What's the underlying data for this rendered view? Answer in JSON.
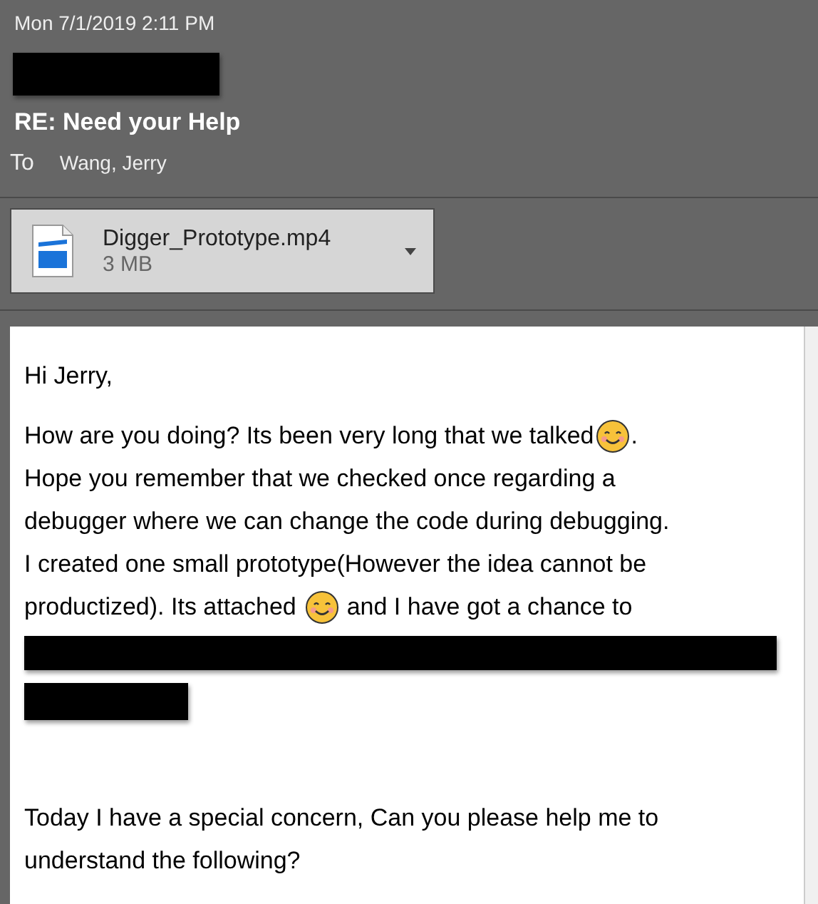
{
  "header": {
    "date": "Mon 7/1/2019 2:11 PM",
    "sender_redacted": true,
    "subject": "RE: Need your Help",
    "to_label": "To",
    "to": "Wang, Jerry"
  },
  "attachment": {
    "name": "Digger_Prototype.mp4",
    "size": "3 MB"
  },
  "body": [
    {
      "kind": "text",
      "segments": [
        {
          "kind": "text",
          "text": "Hi Jerry,"
        }
      ]
    },
    {
      "kind": "gap"
    },
    {
      "kind": "text",
      "segments": [
        {
          "kind": "text",
          "text": "How are you doing? Its been very long that we talked"
        },
        {
          "kind": "emoji"
        },
        {
          "kind": "text",
          "text": "."
        }
      ]
    },
    {
      "kind": "text",
      "segments": [
        {
          "kind": "text",
          "text": "Hope you remember that we checked once regarding a"
        }
      ]
    },
    {
      "kind": "text",
      "segments": [
        {
          "kind": "text",
          "text": "debugger where we can change the code during debugging."
        }
      ]
    },
    {
      "kind": "text",
      "segments": [
        {
          "kind": "text",
          "text": "I created one small prototype(However the idea cannot be"
        }
      ]
    },
    {
      "kind": "text",
      "segments": [
        {
          "kind": "text",
          "text": "productized). Its attached "
        },
        {
          "kind": "emoji"
        },
        {
          "kind": "text",
          "text": " and I have got a chance to"
        }
      ]
    },
    {
      "kind": "redacted",
      "wide": true
    },
    {
      "kind": "redacted",
      "wide": false
    },
    {
      "kind": "blank"
    },
    {
      "kind": "text",
      "segments": [
        {
          "kind": "text",
          "text": "Today I have a special concern, Can you please help me to"
        }
      ]
    },
    {
      "kind": "text",
      "segments": [
        {
          "kind": "text",
          "text": "understand the following?"
        }
      ]
    }
  ]
}
